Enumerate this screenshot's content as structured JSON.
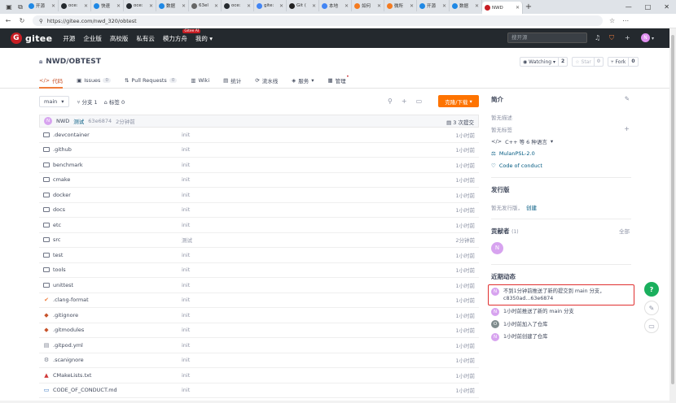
{
  "browser": {
    "tabs": [
      {
        "label": "开源",
        "color": "#1e88e5"
      },
      {
        "label": "oce:",
        "color": "#24292e"
      },
      {
        "label": "快速",
        "color": "#1e88e5"
      },
      {
        "label": "oce:",
        "color": "#24292e"
      },
      {
        "label": "数据",
        "color": "#1e88e5"
      },
      {
        "label": "63el",
        "color": "#666666"
      },
      {
        "label": "oce:",
        "color": "#24292e"
      },
      {
        "label": "gite:",
        "color": "#4285f4"
      },
      {
        "label": "Git (",
        "color": "#222222"
      },
      {
        "label": "本地",
        "color": "#4285f4"
      },
      {
        "label": "如何",
        "color": "#f47b20"
      },
      {
        "label": "微所",
        "color": "#f47b20"
      },
      {
        "label": "开源",
        "color": "#1e88e5"
      },
      {
        "label": "数据",
        "color": "#1e88e5"
      }
    ],
    "active_tab": {
      "label": "NWD",
      "color": "#c71d23"
    },
    "url": "https://gitee.com/nwd_320/obtest"
  },
  "gitee_nav": {
    "logo": "gitee",
    "items": [
      "开源",
      "企业版",
      "高校版",
      "私有云",
      "模力方舟",
      "我的"
    ],
    "ai_badge": "Gitee AI",
    "search_placeholder": "搜开源",
    "avatar_letter": "N"
  },
  "repo": {
    "title": "NWD/OBTEST",
    "watching_label": "Watching",
    "watching_count": "2",
    "star_label": "Star",
    "star_count": "0",
    "fork_label": "Fork",
    "fork_count": "0",
    "tabs": [
      {
        "label": "代码",
        "icon": "</>",
        "badge": ""
      },
      {
        "label": "Issues",
        "icon": "▣",
        "badge": "0"
      },
      {
        "label": "Pull Requests",
        "icon": "⇅",
        "badge": "0"
      },
      {
        "label": "Wiki",
        "icon": "▥",
        "badge": ""
      },
      {
        "label": "统计",
        "icon": "▤",
        "badge": ""
      },
      {
        "label": "流水线",
        "icon": "⟳",
        "badge": ""
      },
      {
        "label": "服务",
        "icon": "◈",
        "badge": ""
      },
      {
        "label": "管理",
        "icon": "▦",
        "badge": ""
      }
    ]
  },
  "toolbar": {
    "branch": "main",
    "branches": "分支 1",
    "tags": "标签 0",
    "download": "克隆/下载"
  },
  "commit": {
    "avatar_letter": "N",
    "author": "NWD",
    "message": "测试",
    "sha": "63e6874",
    "time": "2分钟前",
    "count": "3 次提交"
  },
  "files": [
    {
      "name": ".devcontainer",
      "type": "folder",
      "msg": "init",
      "time": "1小时前"
    },
    {
      "name": ".github",
      "type": "folder",
      "msg": "init",
      "time": "1小时前"
    },
    {
      "name": "benchmark",
      "type": "folder",
      "msg": "init",
      "time": "1小时前"
    },
    {
      "name": "cmake",
      "type": "folder",
      "msg": "init",
      "time": "1小时前"
    },
    {
      "name": "docker",
      "type": "folder",
      "msg": "init",
      "time": "1小时前"
    },
    {
      "name": "docs",
      "type": "folder",
      "msg": "init",
      "time": "1小时前"
    },
    {
      "name": "etc",
      "type": "folder",
      "msg": "init",
      "time": "1小时前"
    },
    {
      "name": "src",
      "type": "folder",
      "msg": "测试",
      "time": "2分钟前"
    },
    {
      "name": "test",
      "type": "folder",
      "msg": "init",
      "time": "1小时前"
    },
    {
      "name": "tools",
      "type": "folder",
      "msg": "init",
      "time": "1小时前"
    },
    {
      "name": "unittest",
      "type": "folder",
      "msg": "init",
      "time": "1小时前"
    },
    {
      "name": ".clang-format",
      "type": "clang",
      "msg": "init",
      "time": "1小时前"
    },
    {
      "name": ".gitignore",
      "type": "git",
      "msg": "init",
      "time": "1小时前"
    },
    {
      "name": ".gitmodules",
      "type": "git",
      "msg": "init",
      "time": "1小时前"
    },
    {
      "name": ".gitpod.yml",
      "type": "file",
      "msg": "init",
      "time": "1小时前"
    },
    {
      "name": ".scanignore",
      "type": "gear",
      "msg": "init",
      "time": "1小时前"
    },
    {
      "name": "CMakeLists.txt",
      "type": "cmake",
      "msg": "init",
      "time": "1小时前"
    },
    {
      "name": "CODE_OF_CONDUCT.md",
      "type": "md",
      "msg": "init",
      "time": "1小时前"
    }
  ],
  "sidebar": {
    "intro_title": "简介",
    "no_desc": "暂无描述",
    "no_tags": "暂无标签",
    "lang": "C++ 等 6 种语言",
    "license": "MulanPSL-2.0",
    "coc": "Code of conduct",
    "release_title": "发行版",
    "no_release": "暂无发行版，",
    "create": "创建",
    "contrib_title": "贡献者",
    "contrib_count": "(1)",
    "contrib_all": "全部",
    "contrib_letter": "N",
    "activity_title": "近期动态",
    "activities": [
      {
        "letter": "N",
        "text": "不到1分钟前推送了新的提交到 main 分支，c8350ad...63e6874",
        "highlight": true
      },
      {
        "letter": "N",
        "text": "1小时前推送了新的 main 分支",
        "highlight": false
      },
      {
        "letter": "O",
        "text": "1小时前加入了仓库",
        "highlight": false
      },
      {
        "letter": "N",
        "text": "1小时前创建了仓库",
        "highlight": false
      }
    ]
  },
  "fab": {
    "help": "?"
  }
}
